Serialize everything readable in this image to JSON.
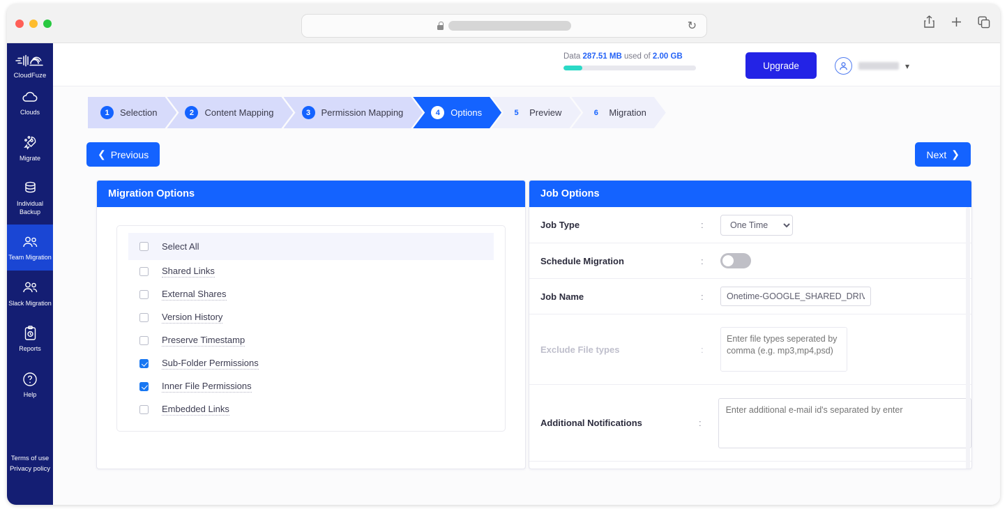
{
  "browser": {
    "url_redacted": true,
    "lock_icon": "lock-icon",
    "reload_icon": "reload-icon",
    "share_icon": "share-icon",
    "new_tab_icon": "plus-icon",
    "tabs_icon": "tabs-icon"
  },
  "sidebar": {
    "brand": "CloudFuze",
    "items": [
      {
        "label": "Clouds",
        "icon": "cloud-icon",
        "active": false
      },
      {
        "label": "Migrate",
        "icon": "rocket-icon",
        "active": false
      },
      {
        "label": "Individual Backup",
        "icon": "database-icon",
        "active": false
      },
      {
        "label": "Team Migration",
        "icon": "people-icon",
        "active": true
      },
      {
        "label": "Slack Migration",
        "icon": "people-icon",
        "active": false
      },
      {
        "label": "Reports",
        "icon": "clipboard-icon",
        "active": false
      },
      {
        "label": "Help",
        "icon": "question-circle-icon",
        "active": false
      }
    ],
    "footer": [
      "Terms of use",
      "Privacy policy"
    ]
  },
  "header": {
    "usage_prefix": "Data",
    "usage_used": "287.51 MB",
    "usage_middle": "used of",
    "usage_total": "2.00 GB",
    "usage_percent": 14,
    "upgrade_label": "Upgrade",
    "account_redacted": true
  },
  "stepper": [
    {
      "num": "1",
      "label": "Selection",
      "state": "done"
    },
    {
      "num": "2",
      "label": "Content Mapping",
      "state": "done"
    },
    {
      "num": "3",
      "label": "Permission Mapping",
      "state": "done"
    },
    {
      "num": "4",
      "label": "Options",
      "state": "active"
    },
    {
      "num": "5",
      "label": "Preview",
      "state": "todo"
    },
    {
      "num": "6",
      "label": "Migration",
      "state": "todo"
    }
  ],
  "nav": {
    "previous_label": "Previous",
    "next_label": "Next"
  },
  "migration_options": {
    "title": "Migration Options",
    "select_all": {
      "label": "Select All",
      "checked": false
    },
    "items": [
      {
        "label": "Shared Links",
        "checked": false
      },
      {
        "label": "External Shares",
        "checked": false
      },
      {
        "label": "Version History",
        "checked": false
      },
      {
        "label": "Preserve Timestamp",
        "checked": false
      },
      {
        "label": "Sub-Folder Permissions",
        "checked": true
      },
      {
        "label": "Inner File Permissions",
        "checked": true
      },
      {
        "label": "Embedded Links",
        "checked": false
      }
    ]
  },
  "job_options": {
    "title": "Job Options",
    "colon": ":",
    "job_type": {
      "label": "Job Type",
      "value": "One Time",
      "options": [
        "One Time"
      ]
    },
    "schedule_migration": {
      "label": "Schedule Migration",
      "enabled": false
    },
    "job_name": {
      "label": "Job Name",
      "value": "Onetime-GOOGLE_SHARED_DRIVES"
    },
    "exclude_file_types": {
      "label": "Exclude File types",
      "placeholder": "Enter file types seperated by comma (e.g. mp3,mp4,psd)",
      "disabled": true
    },
    "additional_notifications": {
      "label": "Additional Notifications",
      "placeholder": "Enter additional e-mail id's separated by enter"
    }
  },
  "colors": {
    "brand_navy": "#141e73",
    "accent_blue": "#1463ff",
    "upgrade_blue": "#2323e6",
    "usage_teal": "#2bd9c6",
    "step_done": "#d7dbfb",
    "step_todo": "#eff0fb"
  }
}
